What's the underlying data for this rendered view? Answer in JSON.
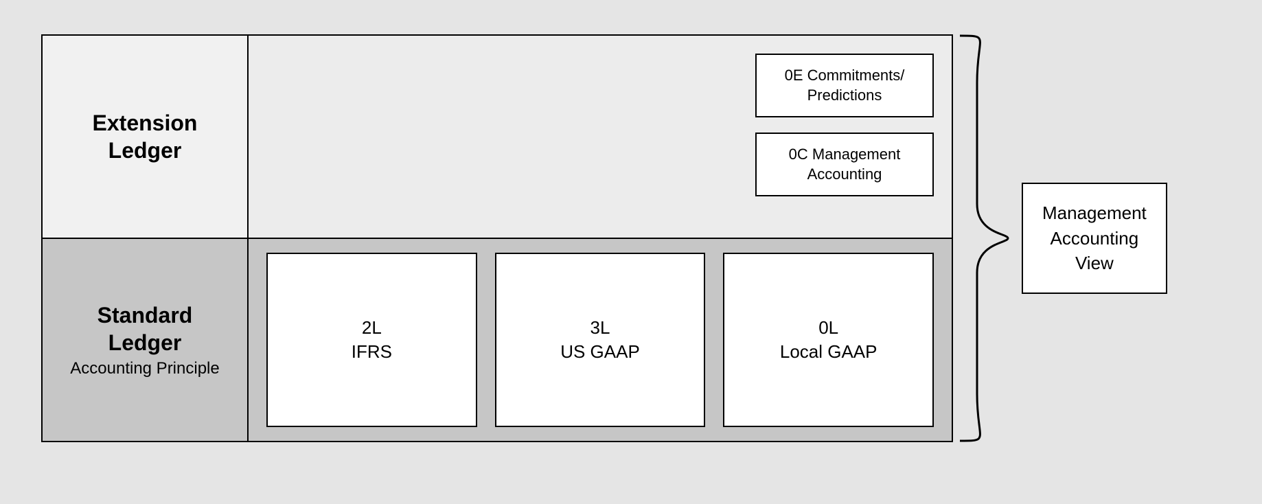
{
  "rows": {
    "extension": {
      "title_line1": "Extension",
      "title_line2": "Ledger",
      "boxes": {
        "b0_line1": "0E Commitments/",
        "b0_line2": "Predictions",
        "b1_line1": "0C Management",
        "b1_line2": "Accounting"
      }
    },
    "standard": {
      "title_line1": "Standard",
      "title_line2": "Ledger",
      "subtitle": "Accounting Principle",
      "boxes": {
        "c0_line1": "2L",
        "c0_line2": "IFRS",
        "c1_line1": "3L",
        "c1_line2": "US GAAP",
        "c2_line1": "0L",
        "c2_line2": "Local GAAP"
      }
    }
  },
  "mgmt": {
    "line1": "Management",
    "line2": "Accounting",
    "line3": "View"
  }
}
